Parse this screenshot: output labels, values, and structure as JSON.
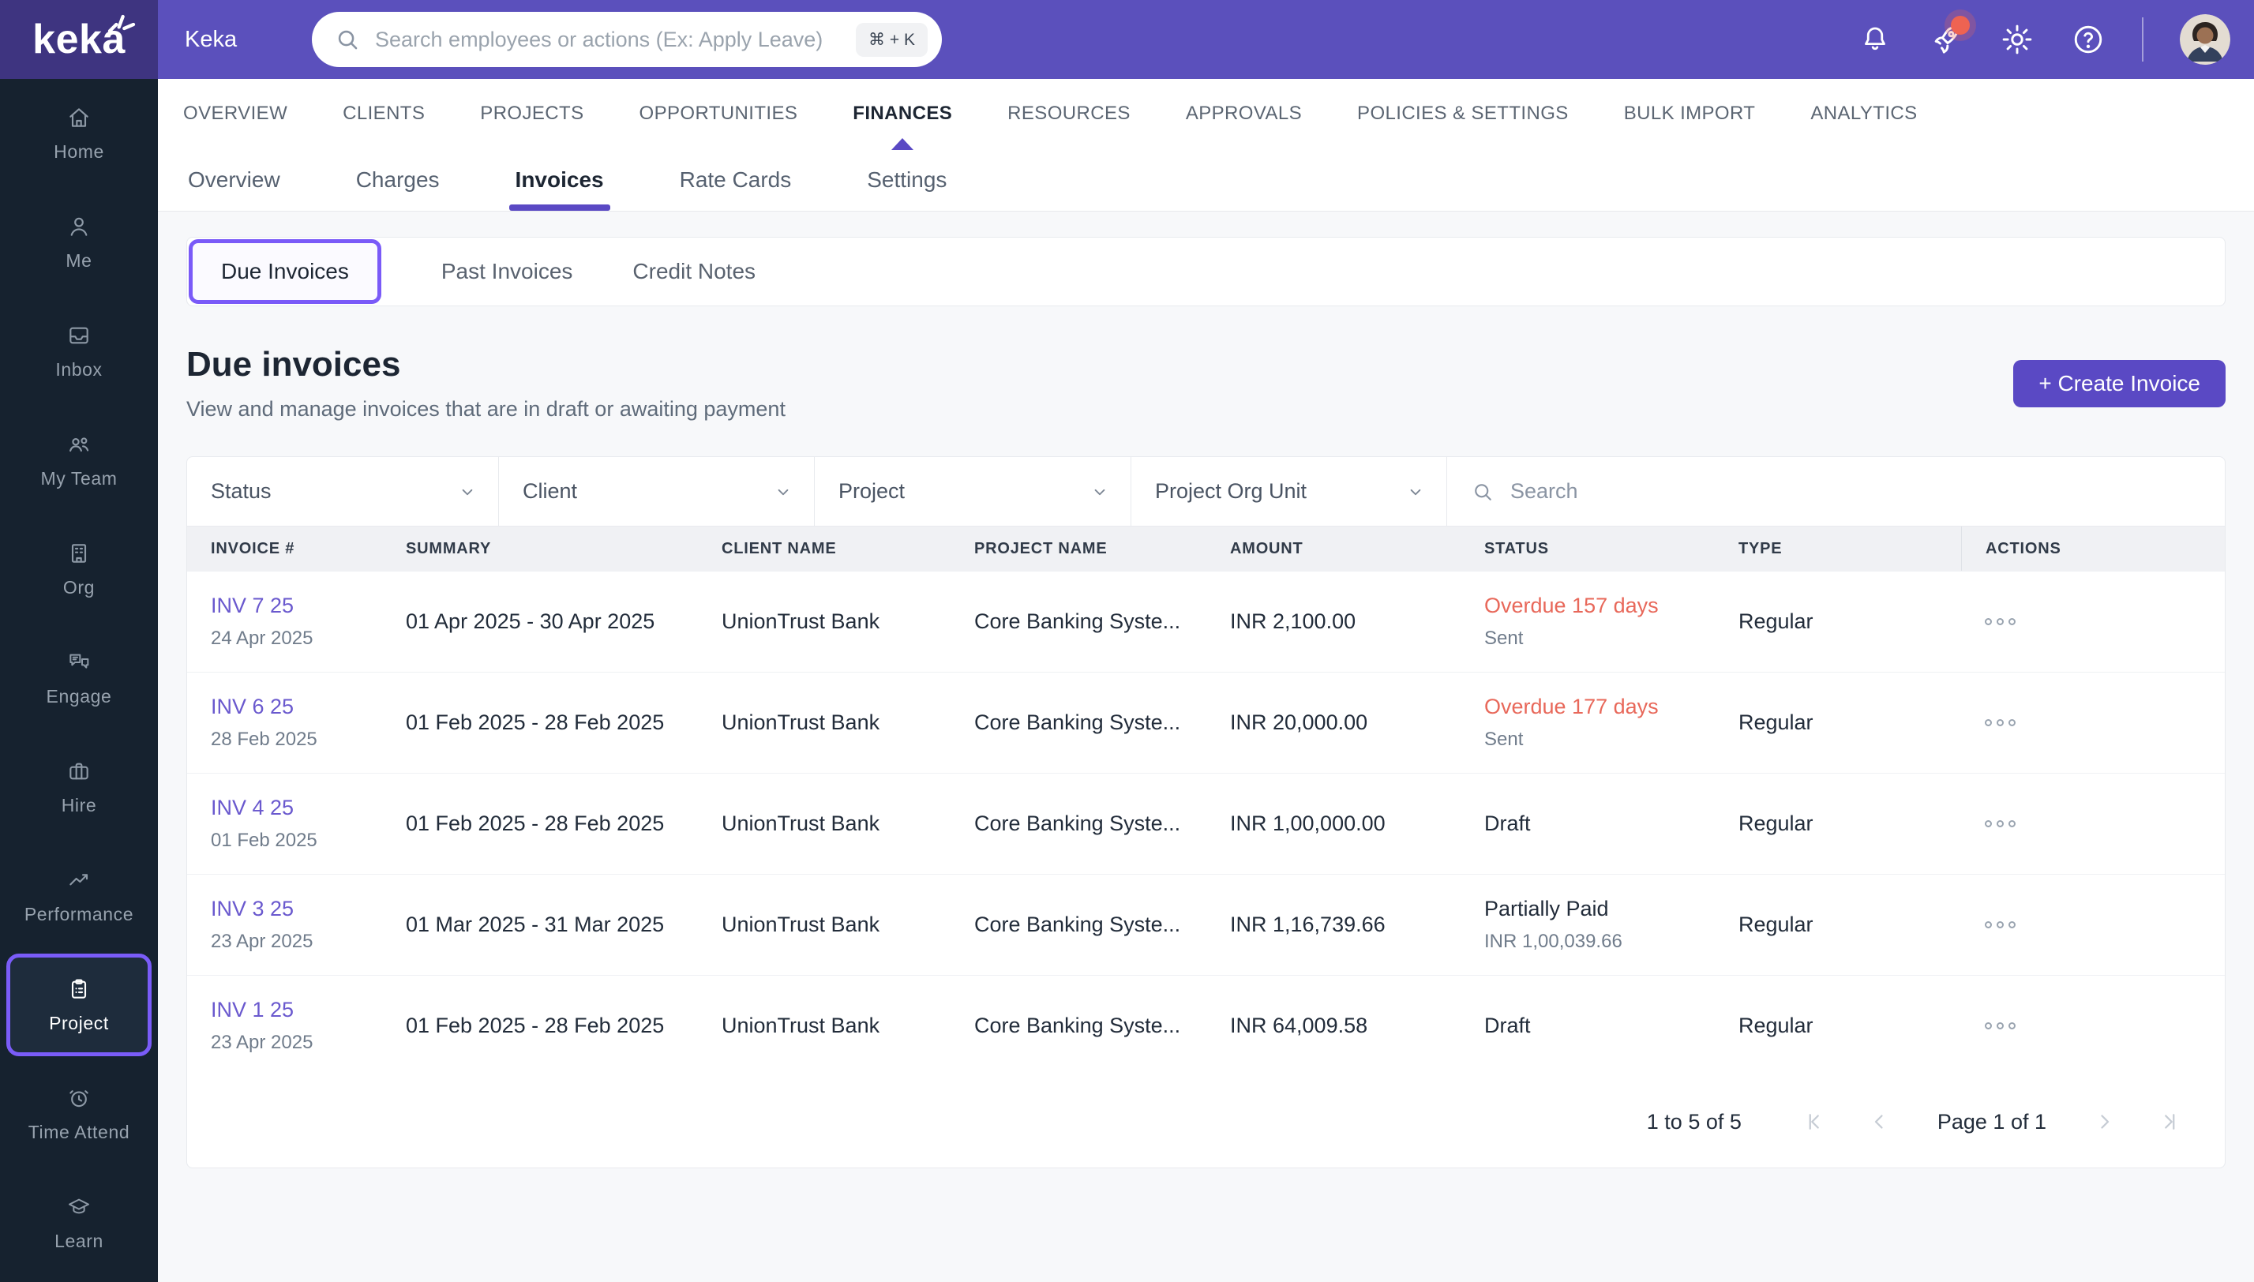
{
  "colors": {
    "topbar": "#5B50BC",
    "logo_block": "#3E3480",
    "sidebar": "#16222F",
    "accent": "#5A49C4",
    "highlight_border": "#7A5AF8",
    "link": "#6A59CE",
    "overdue": "#E8685A",
    "badge": "#EE6352",
    "page_bg": "#F7F8FA"
  },
  "topbar": {
    "logo_text": "keka",
    "brand_title": "Keka",
    "search_placeholder": "Search employees or actions (Ex: Apply Leave)",
    "shortcut_label": "⌘ + K",
    "icons": [
      "bell-icon",
      "rocket-icon",
      "gear-icon",
      "help-icon",
      "avatar"
    ]
  },
  "sidebar": {
    "items": [
      {
        "label": "Home",
        "icon": "home-icon",
        "active": false
      },
      {
        "label": "Me",
        "icon": "user-icon",
        "active": false
      },
      {
        "label": "Inbox",
        "icon": "inbox-icon",
        "active": false
      },
      {
        "label": "My Team",
        "icon": "users-icon",
        "active": false
      },
      {
        "label": "Org",
        "icon": "building-icon",
        "active": false
      },
      {
        "label": "Engage",
        "icon": "chat-icon",
        "active": false
      },
      {
        "label": "Hire",
        "icon": "briefcase-icon",
        "active": false
      },
      {
        "label": "Performance",
        "icon": "trend-icon",
        "active": false
      },
      {
        "label": "Project",
        "icon": "clipboard-icon",
        "active": true
      },
      {
        "label": "Time Attend",
        "icon": "alarm-clock-icon",
        "active": false
      },
      {
        "label": "Learn",
        "icon": "graduation-cap-icon",
        "active": false
      }
    ]
  },
  "primary_nav": {
    "items": [
      {
        "label": "OVERVIEW",
        "active": false
      },
      {
        "label": "CLIENTS",
        "active": false
      },
      {
        "label": "PROJECTS",
        "active": false
      },
      {
        "label": "OPPORTUNITIES",
        "active": false
      },
      {
        "label": "FINANCES",
        "active": true
      },
      {
        "label": "RESOURCES",
        "active": false
      },
      {
        "label": "APPROVALS",
        "active": false
      },
      {
        "label": "POLICIES & SETTINGS",
        "active": false
      },
      {
        "label": "BULK IMPORT",
        "active": false
      },
      {
        "label": "ANALYTICS",
        "active": false
      }
    ]
  },
  "sub_nav": {
    "items": [
      {
        "label": "Overview",
        "active": false
      },
      {
        "label": "Charges",
        "active": false
      },
      {
        "label": "Invoices",
        "active": true
      },
      {
        "label": "Rate Cards",
        "active": false
      },
      {
        "label": "Settings",
        "active": false
      }
    ]
  },
  "invoice_tabs": {
    "items": [
      {
        "label": "Due Invoices",
        "active": true
      },
      {
        "label": "Past Invoices",
        "active": false
      },
      {
        "label": "Credit Notes",
        "active": false
      }
    ]
  },
  "page": {
    "title": "Due invoices",
    "subtitle": "View and manage invoices that are in draft or awaiting payment",
    "create_button": "+ Create Invoice"
  },
  "filters": {
    "dropdowns": [
      {
        "label": "Status"
      },
      {
        "label": "Client"
      },
      {
        "label": "Project"
      },
      {
        "label": "Project Org Unit"
      }
    ],
    "search_placeholder": "Search"
  },
  "table": {
    "columns": [
      "INVOICE #",
      "SUMMARY",
      "CLIENT NAME",
      "PROJECT NAME",
      "AMOUNT",
      "STATUS",
      "TYPE",
      "ACTIONS"
    ],
    "rows": [
      {
        "invoice_no": "INV 7 25",
        "invoice_date": "24 Apr 2025",
        "summary": "01 Apr 2025 - 30 Apr 2025",
        "client": "UnionTrust Bank",
        "project": "Core Banking Syste...",
        "amount": "INR 2,100.00",
        "status_main": "Overdue 157 days",
        "status_sub": "Sent",
        "status_variant": "overdue",
        "type": "Regular"
      },
      {
        "invoice_no": "INV 6 25",
        "invoice_date": "28 Feb 2025",
        "summary": "01 Feb 2025 - 28 Feb 2025",
        "client": "UnionTrust Bank",
        "project": "Core Banking Syste...",
        "amount": "INR 20,000.00",
        "status_main": "Overdue 177 days",
        "status_sub": "Sent",
        "status_variant": "overdue",
        "type": "Regular"
      },
      {
        "invoice_no": "INV 4 25",
        "invoice_date": "01 Feb 2025",
        "summary": "01 Feb 2025 - 28 Feb 2025",
        "client": "UnionTrust Bank",
        "project": "Core Banking Syste...",
        "amount": "INR 1,00,000.00",
        "status_main": "Draft",
        "status_sub": "",
        "status_variant": "neutral",
        "type": "Regular"
      },
      {
        "invoice_no": "INV 3 25",
        "invoice_date": "23 Apr 2025",
        "summary": "01 Mar 2025 - 31 Mar 2025",
        "client": "UnionTrust Bank",
        "project": "Core Banking Syste...",
        "amount": "INR 1,16,739.66",
        "status_main": "Partially Paid",
        "status_sub": "INR 1,00,039.66",
        "status_variant": "neutral",
        "type": "Regular"
      },
      {
        "invoice_no": "INV 1 25",
        "invoice_date": "23 Apr 2025",
        "summary": "01 Feb 2025 - 28 Feb 2025",
        "client": "UnionTrust Bank",
        "project": "Core Banking Syste...",
        "amount": "INR 64,009.58",
        "status_main": "Draft",
        "status_sub": "",
        "status_variant": "neutral",
        "type": "Regular"
      }
    ]
  },
  "pagination": {
    "range_text": "1 to 5 of 5",
    "page_text": "Page 1 of 1"
  }
}
